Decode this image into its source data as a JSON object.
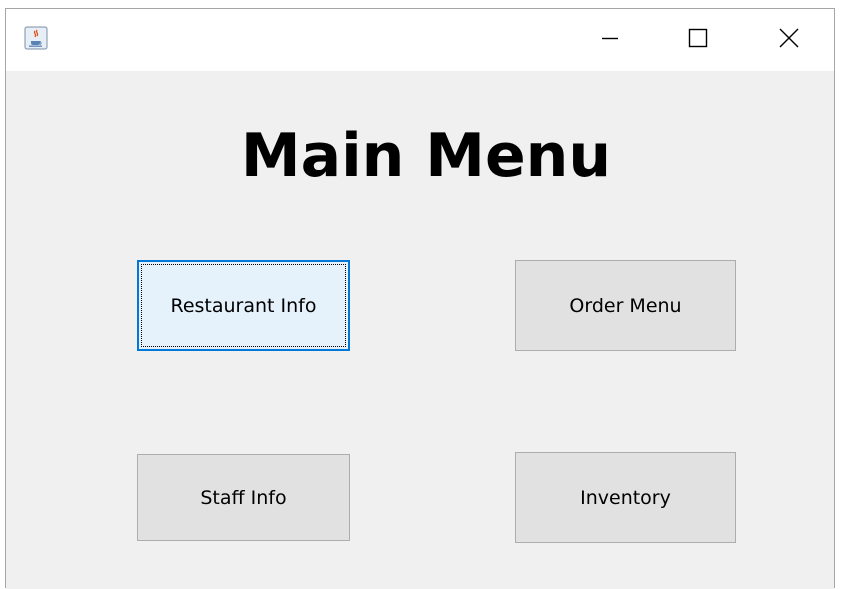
{
  "window": {
    "icon": "java-coffee-cup-icon",
    "controls": {
      "minimize_icon": "minimize-icon",
      "maximize_icon": "maximize-icon",
      "close_icon": "close-icon"
    }
  },
  "main": {
    "title": "Main Menu",
    "buttons": {
      "restaurant_info": "Restaurant Info",
      "order_menu": "Order Menu",
      "staff_info": "Staff Info",
      "inventory": "Inventory"
    }
  },
  "colors": {
    "content_background": "#f0f0f0",
    "button_background": "#e1e1e1",
    "button_border": "#adadad",
    "focused_button_background": "#e5f1fb",
    "focus_accent": "#0078d7"
  }
}
